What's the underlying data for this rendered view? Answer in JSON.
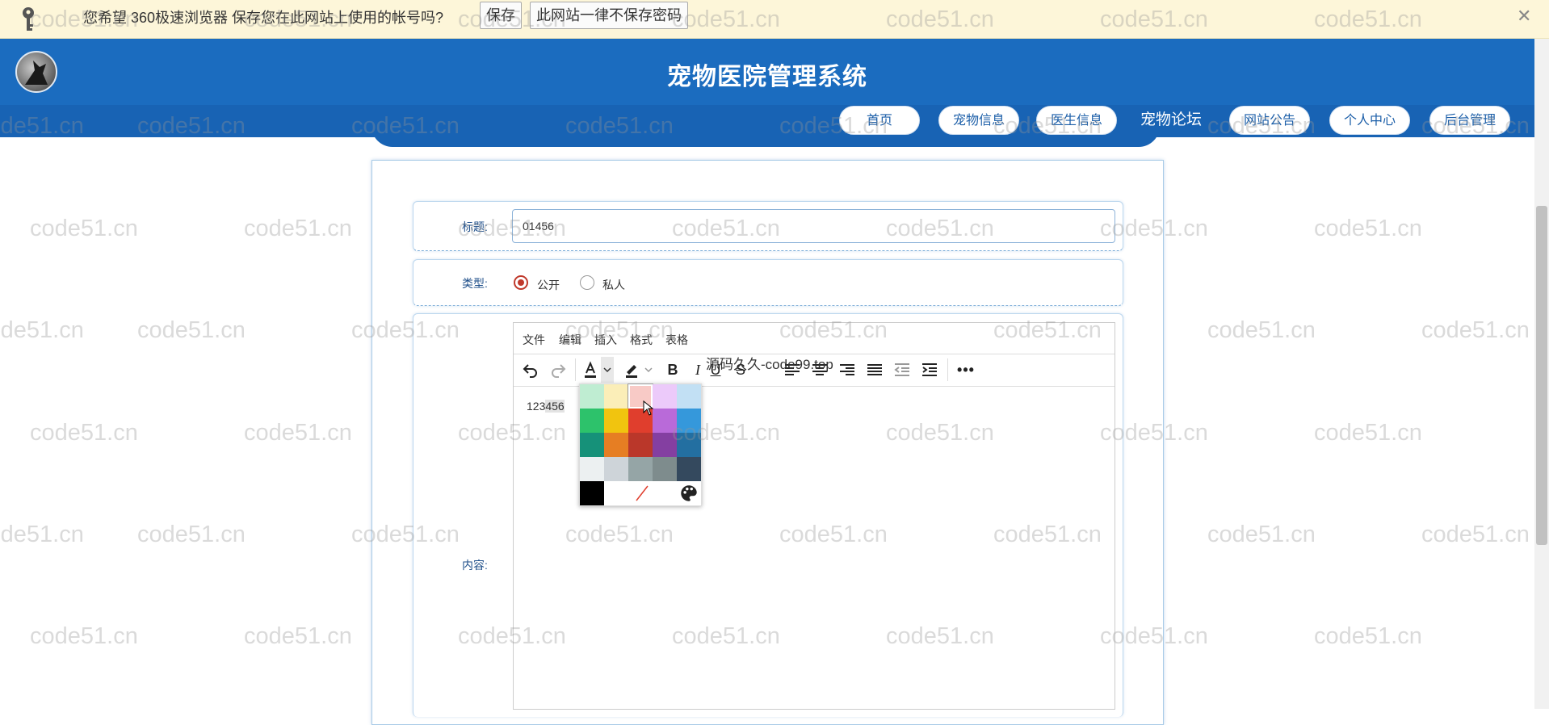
{
  "password_bar": {
    "message": "您希望 360极速浏览器 保存您在此网站上使用的帐号吗?",
    "save_label": "保存",
    "never_label": "此网站一律不保存密码",
    "close": "✕"
  },
  "header": {
    "title": "宠物医院管理系统"
  },
  "nav": {
    "items": [
      {
        "label": "首页"
      },
      {
        "label": "宠物信息"
      },
      {
        "label": "医生信息"
      },
      {
        "label": "宠物论坛"
      },
      {
        "label": "网站公告"
      },
      {
        "label": "个人中心"
      },
      {
        "label": "后台管理"
      }
    ]
  },
  "form": {
    "title_label": "标题:",
    "title_value": "01456",
    "type_label": "类型:",
    "type_options": [
      {
        "label": "公开",
        "selected": true
      },
      {
        "label": "私人",
        "selected": false
      }
    ],
    "content_label": "内容:"
  },
  "editor": {
    "menus": [
      "文件",
      "编辑",
      "插入",
      "格式",
      "表格"
    ],
    "toolbar_icons": [
      "undo-icon",
      "redo-icon",
      "text-color-icon",
      "highlight-color-icon",
      "bold-icon",
      "italic-icon",
      "underline-icon",
      "strikethrough-icon",
      "align-left-icon",
      "align-center-icon",
      "align-right-icon",
      "align-justify-icon",
      "outdent-icon",
      "indent-icon",
      "more-icon"
    ],
    "content_plain": "123",
    "content_selected": "456",
    "overlay_text": "源码久久-code99.top"
  },
  "palette": {
    "colors": [
      "#bfedd2",
      "#fbeeb8",
      "#f8cac6",
      "#eccafa",
      "#c2e0f4",
      "#2dc26b",
      "#f1c40f",
      "#e03e2d",
      "#b96ad9",
      "#3598db",
      "#169179",
      "#e67e23",
      "#ba372a",
      "#843fa1",
      "#236fa1",
      "#ecf0f1",
      "#ced4d9",
      "#95a5a6",
      "#7e8c8d",
      "#34495e",
      "#000000",
      "#ffffff"
    ],
    "selected": "#f8cac6"
  },
  "watermark": "code51.cn"
}
